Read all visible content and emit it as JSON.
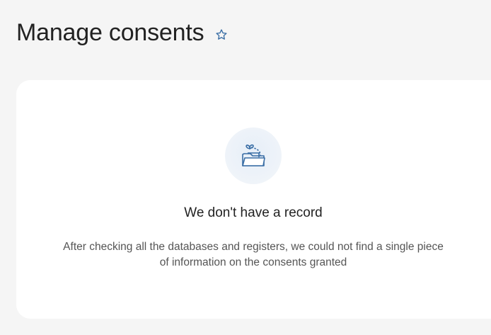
{
  "header": {
    "title": "Manage consents",
    "favorite_icon": "star-outline-icon"
  },
  "empty_state": {
    "icon": "gift-folder-icon",
    "title": "We don't have a record",
    "description": "After checking all the databases and registers, we could not find a single piece of information on the consents granted"
  },
  "colors": {
    "accent": "#3a6ea5",
    "background": "#f5f5f5",
    "card": "#ffffff",
    "title_text": "#222222",
    "body_text": "#555555"
  }
}
